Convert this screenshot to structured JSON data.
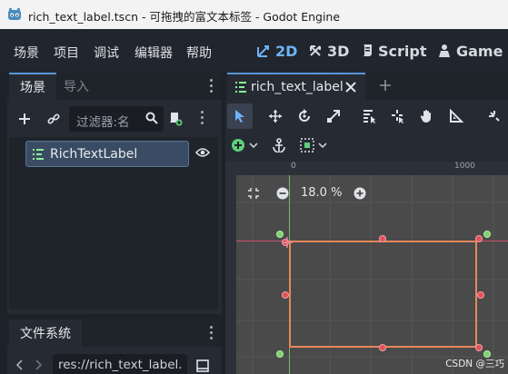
{
  "window": {
    "title": "rich_text_label.tscn - 可拖拽的富文本标签 - Godot Engine",
    "logo_icon": "godot-logo-icon"
  },
  "menubar": {
    "items": [
      "场景",
      "项目",
      "调试",
      "编辑器",
      "帮助"
    ],
    "modes": [
      {
        "label": "2D",
        "icon": "2d-icon",
        "active": true
      },
      {
        "label": "3D",
        "icon": "3d-icon",
        "active": false
      },
      {
        "label": "Script",
        "icon": "script-icon",
        "active": false
      },
      {
        "label": "Game",
        "icon": "game-icon",
        "active": false
      }
    ]
  },
  "scene_dock": {
    "tabs": [
      "场景",
      "导入"
    ],
    "filter_placeholder": "过滤器:名",
    "tree": [
      {
        "label": "RichTextLabel",
        "icon": "rich-text-label-icon",
        "visible_icon": "eye-icon"
      }
    ]
  },
  "fs_dock": {
    "tab": "文件系统",
    "path": "res://rich_text_label."
  },
  "editor": {
    "scene_tab": "rich_text_label",
    "zoom": "18.0 %",
    "ruler_labels": [
      "0",
      "1000"
    ]
  },
  "watermark": "CSDN @三巧",
  "colors": {
    "accent": "#6fb2f7",
    "selection_rect": "#e5875a",
    "x_axis": "#c2526a",
    "y_axis": "#79b86a"
  }
}
